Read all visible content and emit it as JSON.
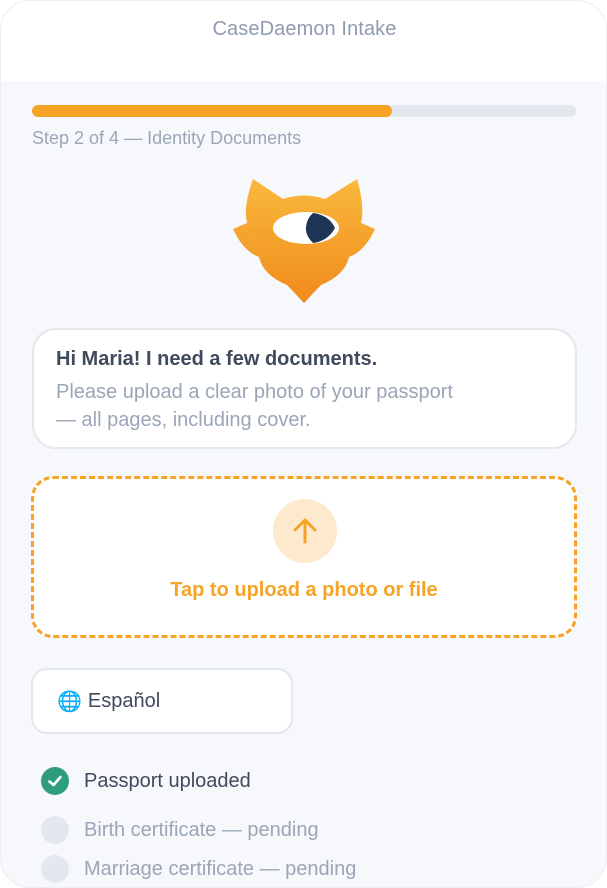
{
  "app": {
    "title": "CaseDaemon Intake"
  },
  "progress": {
    "fraction": 0.662,
    "label": "Step 2 of 4 — Identity Documents"
  },
  "colors": {
    "accent": "#f7a326",
    "accent_soft": "#fde9cd",
    "success": "#2d9d7c",
    "mascot_eye": "#1f3556"
  },
  "message": {
    "title": "Hi Maria! I need a few documents.",
    "body": "Please upload a clear photo of your passport — all pages, including cover."
  },
  "upload": {
    "icon": "upload-arrow-icon",
    "label": "Tap to upload a photo or file"
  },
  "language": {
    "icon": "globe-icon",
    "glyph": "🌐",
    "label": "Español"
  },
  "checklist": [
    {
      "label": "Passport uploaded",
      "status": "done",
      "icon": "check-circle-icon"
    },
    {
      "label": "Birth certificate — pending",
      "status": "pending",
      "icon": "empty-circle-icon"
    },
    {
      "label": "Marriage certificate — pending",
      "status": "pending",
      "icon": "empty-circle-icon"
    }
  ]
}
